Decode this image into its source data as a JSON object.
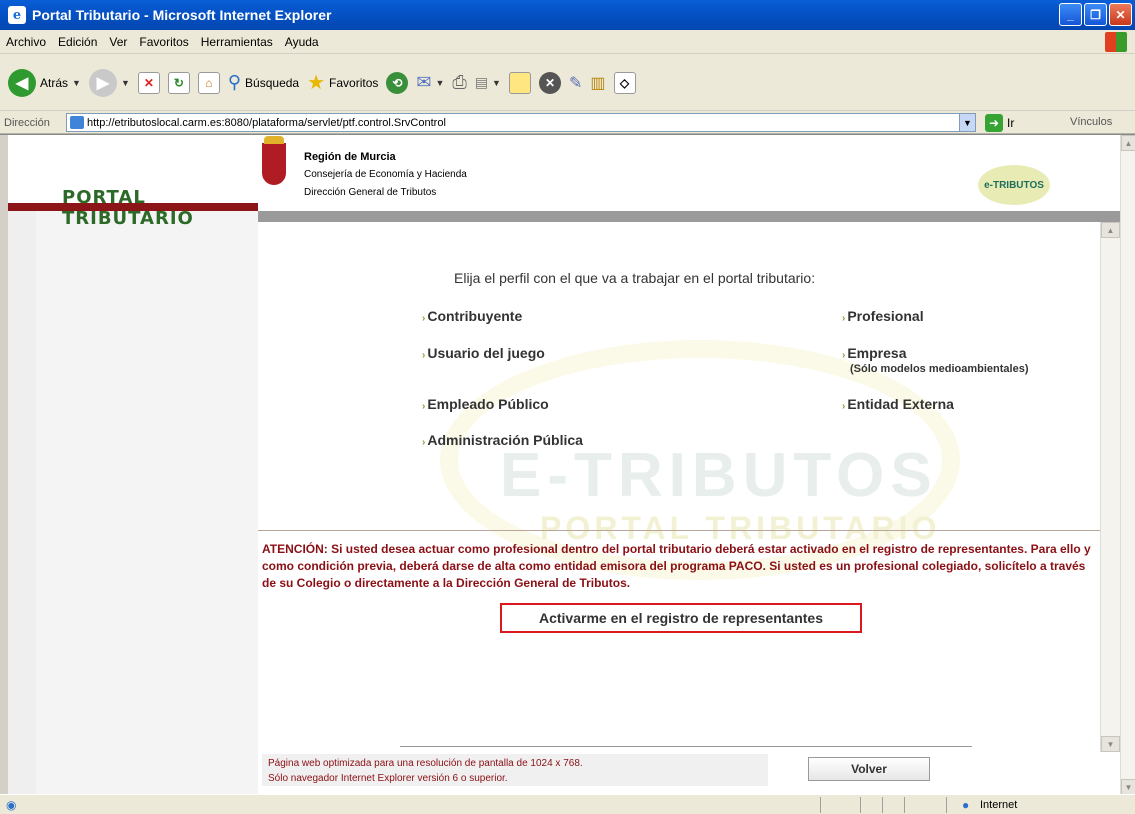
{
  "window": {
    "title": "Portal Tributario - Microsoft Internet Explorer"
  },
  "menu": {
    "items": [
      "Archivo",
      "Edición",
      "Ver",
      "Favoritos",
      "Herramientas",
      "Ayuda"
    ]
  },
  "toolbar": {
    "back_label": "Atrás",
    "search_label": "Búsqueda",
    "favorites_label": "Favoritos"
  },
  "address": {
    "label": "Dirección",
    "url": "http://etributoslocal.carm.es:8080/plataforma/servlet/ptf.control.SrvControl",
    "go_label": "Ir",
    "links_label": "Vínculos"
  },
  "header": {
    "brand": "PORTAL TRIBUTARIO",
    "region": "Región de Murcia",
    "department": "Consejería de Economía y Hacienda",
    "directorate": "Dirección General de Tributos",
    "logo_text": "e-TRIBUTOS"
  },
  "main": {
    "question": "Elija el perfil con el que va a trabajar en el portal tributario:",
    "options": {
      "contribuyente": "Contribuyente",
      "profesional": "Profesional",
      "usuario_juego": "Usuario del juego",
      "empresa": "Empresa",
      "empresa_note": "(Sólo modelos medioambientales)",
      "empleado_publico": "Empleado Público",
      "entidad_externa": "Entidad Externa",
      "administracion_publica": "Administración Pública"
    },
    "watermark": "E-TRIBUTOS",
    "watermark_sub": "PORTAL TRIBUTARIO",
    "warning": "ATENCIÓN: Si usted desea actuar como profesional dentro del portal tributario deberá estar activado en el registro de representantes. Para ello y como condición previa, deberá darse de alta como entidad emisora del programa PACO. Si usted es un profesional colegiado, solicítelo a través de su Colegio o directamente a la Dirección General de Tributos.",
    "register_button": "Activarme en el registro de representantes"
  },
  "footer": {
    "note_line1": "Página web optimizada para una resolución de pantalla de 1024 x 768.",
    "note_line2": "Sólo navegador Internet Explorer versión 6 o superior.",
    "back_button": "Volver"
  },
  "status": {
    "zone": "Internet"
  },
  "colors": {
    "brand_green": "#2d6a28",
    "brand_red": "#8c1517",
    "warning_red": "#8b0f14",
    "button_border": "#d9191e"
  }
}
